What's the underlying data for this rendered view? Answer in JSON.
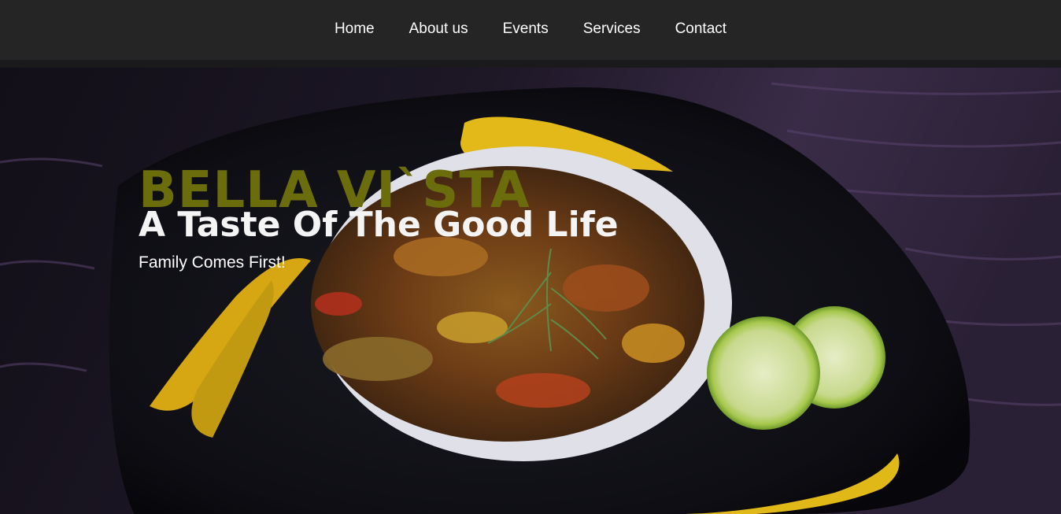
{
  "nav": {
    "items": [
      {
        "label": "Home"
      },
      {
        "label": "About us"
      },
      {
        "label": "Events"
      },
      {
        "label": "Services"
      },
      {
        "label": "Contact"
      }
    ]
  },
  "hero": {
    "brand": "BELLA VI`STA",
    "tagline": "A Taste Of The Good Life",
    "subtagline": "Family Comes First!",
    "image_subject": "plated dish with rice, vegetables, herbs and lime on a dark plate with yellow sauce strokes"
  },
  "colors": {
    "nav_bg": "#252525",
    "brand": "#6b6c0c",
    "tagline": "#f4f4f4",
    "sauce": "#e3b91a",
    "lime": "#9dc04a"
  }
}
